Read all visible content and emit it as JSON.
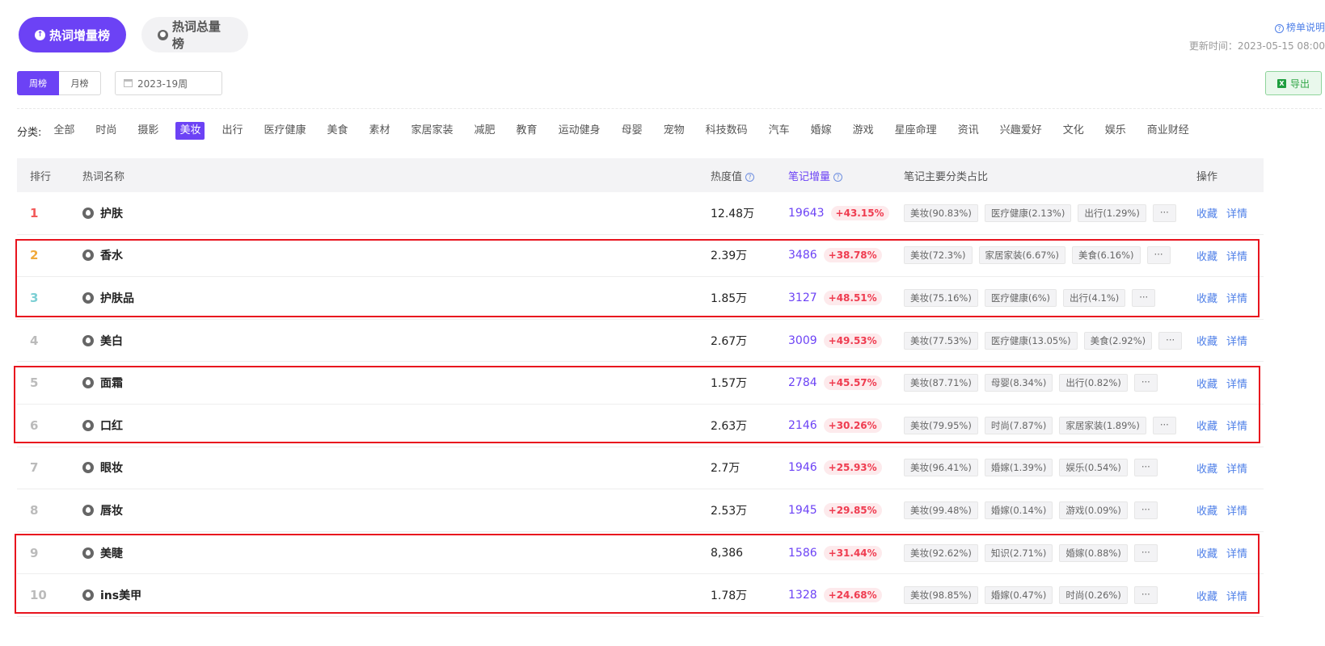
{
  "top_tabs": [
    {
      "label": "热词增量榜",
      "active": true
    },
    {
      "label": "热词总量榜",
      "active": false
    }
  ],
  "help_link": "榜单说明",
  "update_time": "更新时间：2023-05-15 08:00",
  "period": {
    "week": "周榜",
    "month": "月榜",
    "selected": "周榜"
  },
  "date_value": "2023-19周",
  "export_label": "导出",
  "category_label": "分类:",
  "categories": [
    "全部",
    "时尚",
    "摄影",
    "美妆",
    "出行",
    "医疗健康",
    "美食",
    "素材",
    "家居家装",
    "减肥",
    "教育",
    "运动健身",
    "母婴",
    "宠物",
    "科技数码",
    "汽车",
    "婚嫁",
    "游戏",
    "星座命理",
    "资讯",
    "兴趣爱好",
    "文化",
    "娱乐",
    "商业财经"
  ],
  "selected_category": "美妆",
  "table": {
    "headers": {
      "rank": "排行",
      "name": "热词名称",
      "hot": "热度值",
      "increase": "笔记增量",
      "category_share": "笔记主要分类占比",
      "action": "操作"
    },
    "action_labels": {
      "fav": "收藏",
      "detail": "详情"
    },
    "more_label": "···",
    "rows": [
      {
        "rank": "1",
        "word": "护肤",
        "hot": "12.48万",
        "increase": "19643",
        "pct": "+43.15%",
        "cats": [
          "美妆(90.83%)",
          "医疗健康(2.13%)",
          "出行(1.29%)"
        ]
      },
      {
        "rank": "2",
        "word": "香水",
        "hot": "2.39万",
        "increase": "3486",
        "pct": "+38.78%",
        "cats": [
          "美妆(72.3%)",
          "家居家装(6.67%)",
          "美食(6.16%)"
        ]
      },
      {
        "rank": "3",
        "word": "护肤品",
        "hot": "1.85万",
        "increase": "3127",
        "pct": "+48.51%",
        "cats": [
          "美妆(75.16%)",
          "医疗健康(6%)",
          "出行(4.1%)"
        ]
      },
      {
        "rank": "4",
        "word": "美白",
        "hot": "2.67万",
        "increase": "3009",
        "pct": "+49.53%",
        "cats": [
          "美妆(77.53%)",
          "医疗健康(13.05%)",
          "美食(2.92%)"
        ]
      },
      {
        "rank": "5",
        "word": "面霜",
        "hot": "1.57万",
        "increase": "2784",
        "pct": "+45.57%",
        "cats": [
          "美妆(87.71%)",
          "母婴(8.34%)",
          "出行(0.82%)"
        ]
      },
      {
        "rank": "6",
        "word": "口红",
        "hot": "2.63万",
        "increase": "2146",
        "pct": "+30.26%",
        "cats": [
          "美妆(79.95%)",
          "时尚(7.87%)",
          "家居家装(1.89%)"
        ]
      },
      {
        "rank": "7",
        "word": "眼妆",
        "hot": "2.7万",
        "increase": "1946",
        "pct": "+25.93%",
        "cats": [
          "美妆(96.41%)",
          "婚嫁(1.39%)",
          "娱乐(0.54%)"
        ]
      },
      {
        "rank": "8",
        "word": "唇妆",
        "hot": "2.53万",
        "increase": "1945",
        "pct": "+29.85%",
        "cats": [
          "美妆(99.48%)",
          "婚嫁(0.14%)",
          "游戏(0.09%)"
        ]
      },
      {
        "rank": "9",
        "word": "美睫",
        "hot": "8,386",
        "increase": "1586",
        "pct": "+31.44%",
        "cats": [
          "美妆(92.62%)",
          "知识(2.71%)",
          "婚嫁(0.88%)"
        ]
      },
      {
        "rank": "10",
        "word": "ins美甲",
        "hot": "1.78万",
        "increase": "1328",
        "pct": "+24.68%",
        "cats": [
          "美妆(98.85%)",
          "婚嫁(0.47%)",
          "时尚(0.26%)"
        ]
      }
    ]
  },
  "highlight_color": "#e8141e",
  "accent_color": "#6c42f5"
}
